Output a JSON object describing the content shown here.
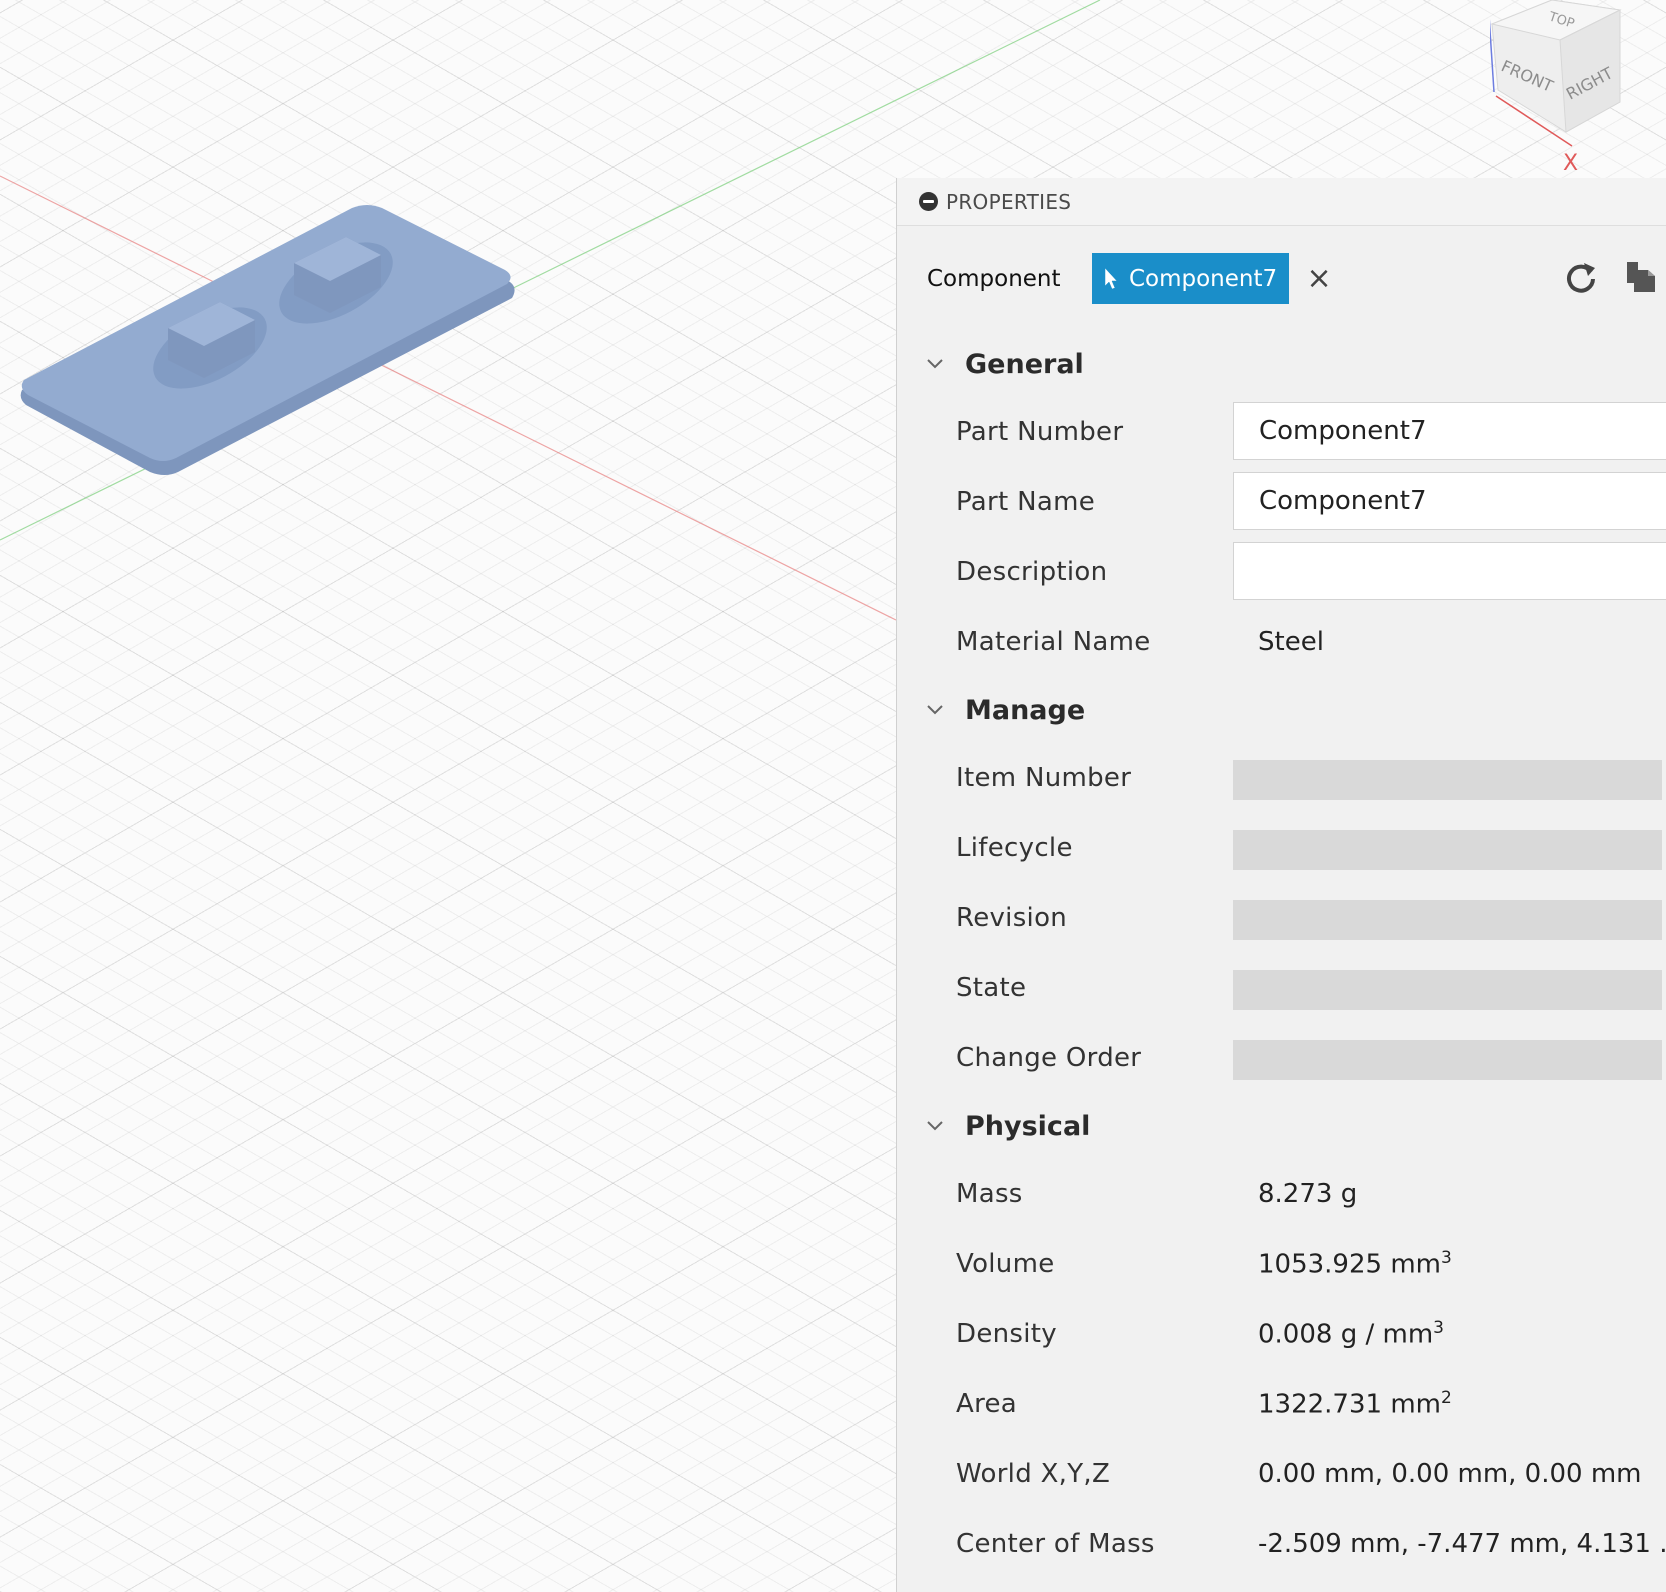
{
  "viewcube": {
    "faces": {
      "top": "TOP",
      "front": "FRONT",
      "right": "RIGHT"
    },
    "axis_x": "X"
  },
  "panel": {
    "title": "PROPERTIES",
    "selector": {
      "label": "Component",
      "chip": "Component7",
      "close": "×"
    },
    "sections": {
      "general": {
        "title": "General",
        "part_number": {
          "label": "Part Number",
          "value": "Component7"
        },
        "part_name": {
          "label": "Part Name",
          "value": "Component7"
        },
        "description": {
          "label": "Description",
          "value": ""
        },
        "material": {
          "label": "Material Name",
          "value": "Steel"
        }
      },
      "manage": {
        "title": "Manage",
        "item_number": "Item Number",
        "lifecycle": "Lifecycle",
        "revision": "Revision",
        "state": "State",
        "change_order": "Change Order"
      },
      "physical": {
        "title": "Physical",
        "mass": {
          "label": "Mass",
          "value": "8.273 g"
        },
        "volume": {
          "label": "Volume",
          "value": "1053.925 mm",
          "exp": "3"
        },
        "density": {
          "label": "Density",
          "value": "0.008 g / mm",
          "exp": "3"
        },
        "area": {
          "label": "Area",
          "value": "1322.731 mm",
          "exp": "2"
        },
        "world": {
          "label": "World X,Y,Z",
          "value": "0.00 mm, 0.00 mm, 0.00 mm"
        },
        "com": {
          "label": "Center of Mass",
          "value": "-2.509 mm, -7.477 mm, 4.131 ..."
        }
      }
    }
  },
  "colors": {
    "accent": "#1a8ec9",
    "model": "#8fa6c9",
    "axis_x": "#e88080",
    "axis_y": "#7ccf7c"
  }
}
